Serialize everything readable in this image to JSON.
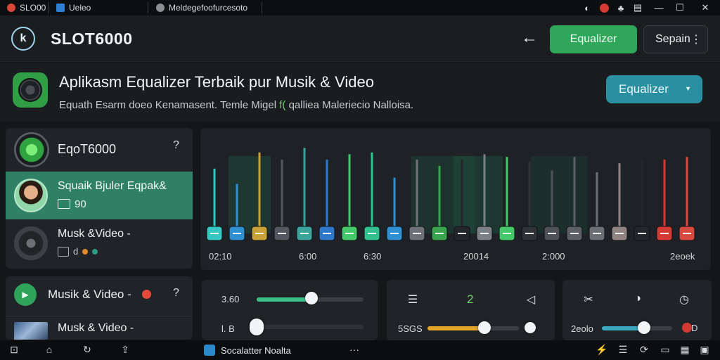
{
  "os_tabs": [
    {
      "label": "SLO00",
      "icon": "red-circle-icon"
    },
    {
      "label": "Ueleo",
      "icon": "blue-square-icon"
    },
    {
      "label": "Meldegefoofurcesoto",
      "icon": "grey-circle-icon"
    }
  ],
  "window_controls": [
    "shield-icon",
    "red-badge-icon",
    "bell-icon",
    "message-icon",
    "minimize-icon",
    "maximize-icon",
    "close-icon"
  ],
  "header": {
    "logo_glyph": "k",
    "title": "SLOT6000",
    "primary_button": "Equalizer",
    "secondary_button": "Sepain"
  },
  "banner": {
    "title": "Aplikasm Equalizer Terbaik pur Musik & Video",
    "subtitle_before": "Equath Esarm doeo Kenamasent. Temle Migel ",
    "subtitle_highlight": "f( ",
    "subtitle_after": "qalliea Maleriecio Nalloisa.",
    "dropdown_label": "Equalizer"
  },
  "sidebar": {
    "header_title": "EqoT6000",
    "selected_item": {
      "title": "Squaik Bjuler Eqpak&",
      "subtitle": "90"
    },
    "item2": {
      "title": "Musk &Video -"
    },
    "card2_title": "Musik & Video -",
    "card2_row_title": "Musk & Video -"
  },
  "equalizer": {
    "axis_labels": [
      "02:10",
      "6:00",
      "6:30",
      "20014",
      "2:000",
      "2eoek"
    ],
    "bands": [
      {
        "color": "#36c7c0",
        "level": 0.72
      },
      {
        "color": "#2f8fd0",
        "level": 0.55
      },
      {
        "color": "#c9a13a",
        "level": 0.9
      },
      {
        "color": "#51575e",
        "level": 0.82
      },
      {
        "color": "#3ba39a",
        "level": 0.95
      },
      {
        "color": "#2f78c8",
        "level": 0.82
      },
      {
        "color": "#45c86a",
        "level": 0.88
      },
      {
        "color": "#32c08e",
        "level": 0.9
      },
      {
        "color": "#2f8fd0",
        "level": 0.62
      },
      {
        "color": "#6c7278",
        "level": 0.82
      },
      {
        "color": "#3aa34e",
        "level": 0.75
      },
      {
        "color": "#23272b",
        "level": 0.82
      },
      {
        "color": "#7a8086",
        "level": 0.88
      },
      {
        "color": "#46c86a",
        "level": 0.85
      },
      {
        "color": "#2f3338",
        "level": 0.8
      },
      {
        "color": "#4c5157",
        "level": 0.7
      },
      {
        "color": "#5b6066",
        "level": 0.85
      },
      {
        "color": "#6b6e72",
        "level": 0.68
      },
      {
        "color": "#8f8481",
        "level": 0.78
      },
      {
        "color": "#23272b",
        "level": 0.82
      },
      {
        "color": "#d23a33",
        "level": 0.82
      },
      {
        "color": "#d74a40",
        "level": 0.85
      }
    ]
  },
  "controls": {
    "card1": {
      "row1_label": "3.60",
      "row1_value": 0.51,
      "row2_label": "l. B",
      "row2_value": 0.0,
      "accent": "#3bbf8a"
    },
    "card2": {
      "center_label": "2",
      "row_label": "5SGS",
      "row_value": 0.62,
      "accent": "#e3a528"
    },
    "card3": {
      "row_label": "2eolo",
      "row_value": 0.6,
      "end_label": "D",
      "accent": "#3aa9bf"
    }
  },
  "taskbar": {
    "app_label": "Socalatter Noalta",
    "more": "···"
  }
}
